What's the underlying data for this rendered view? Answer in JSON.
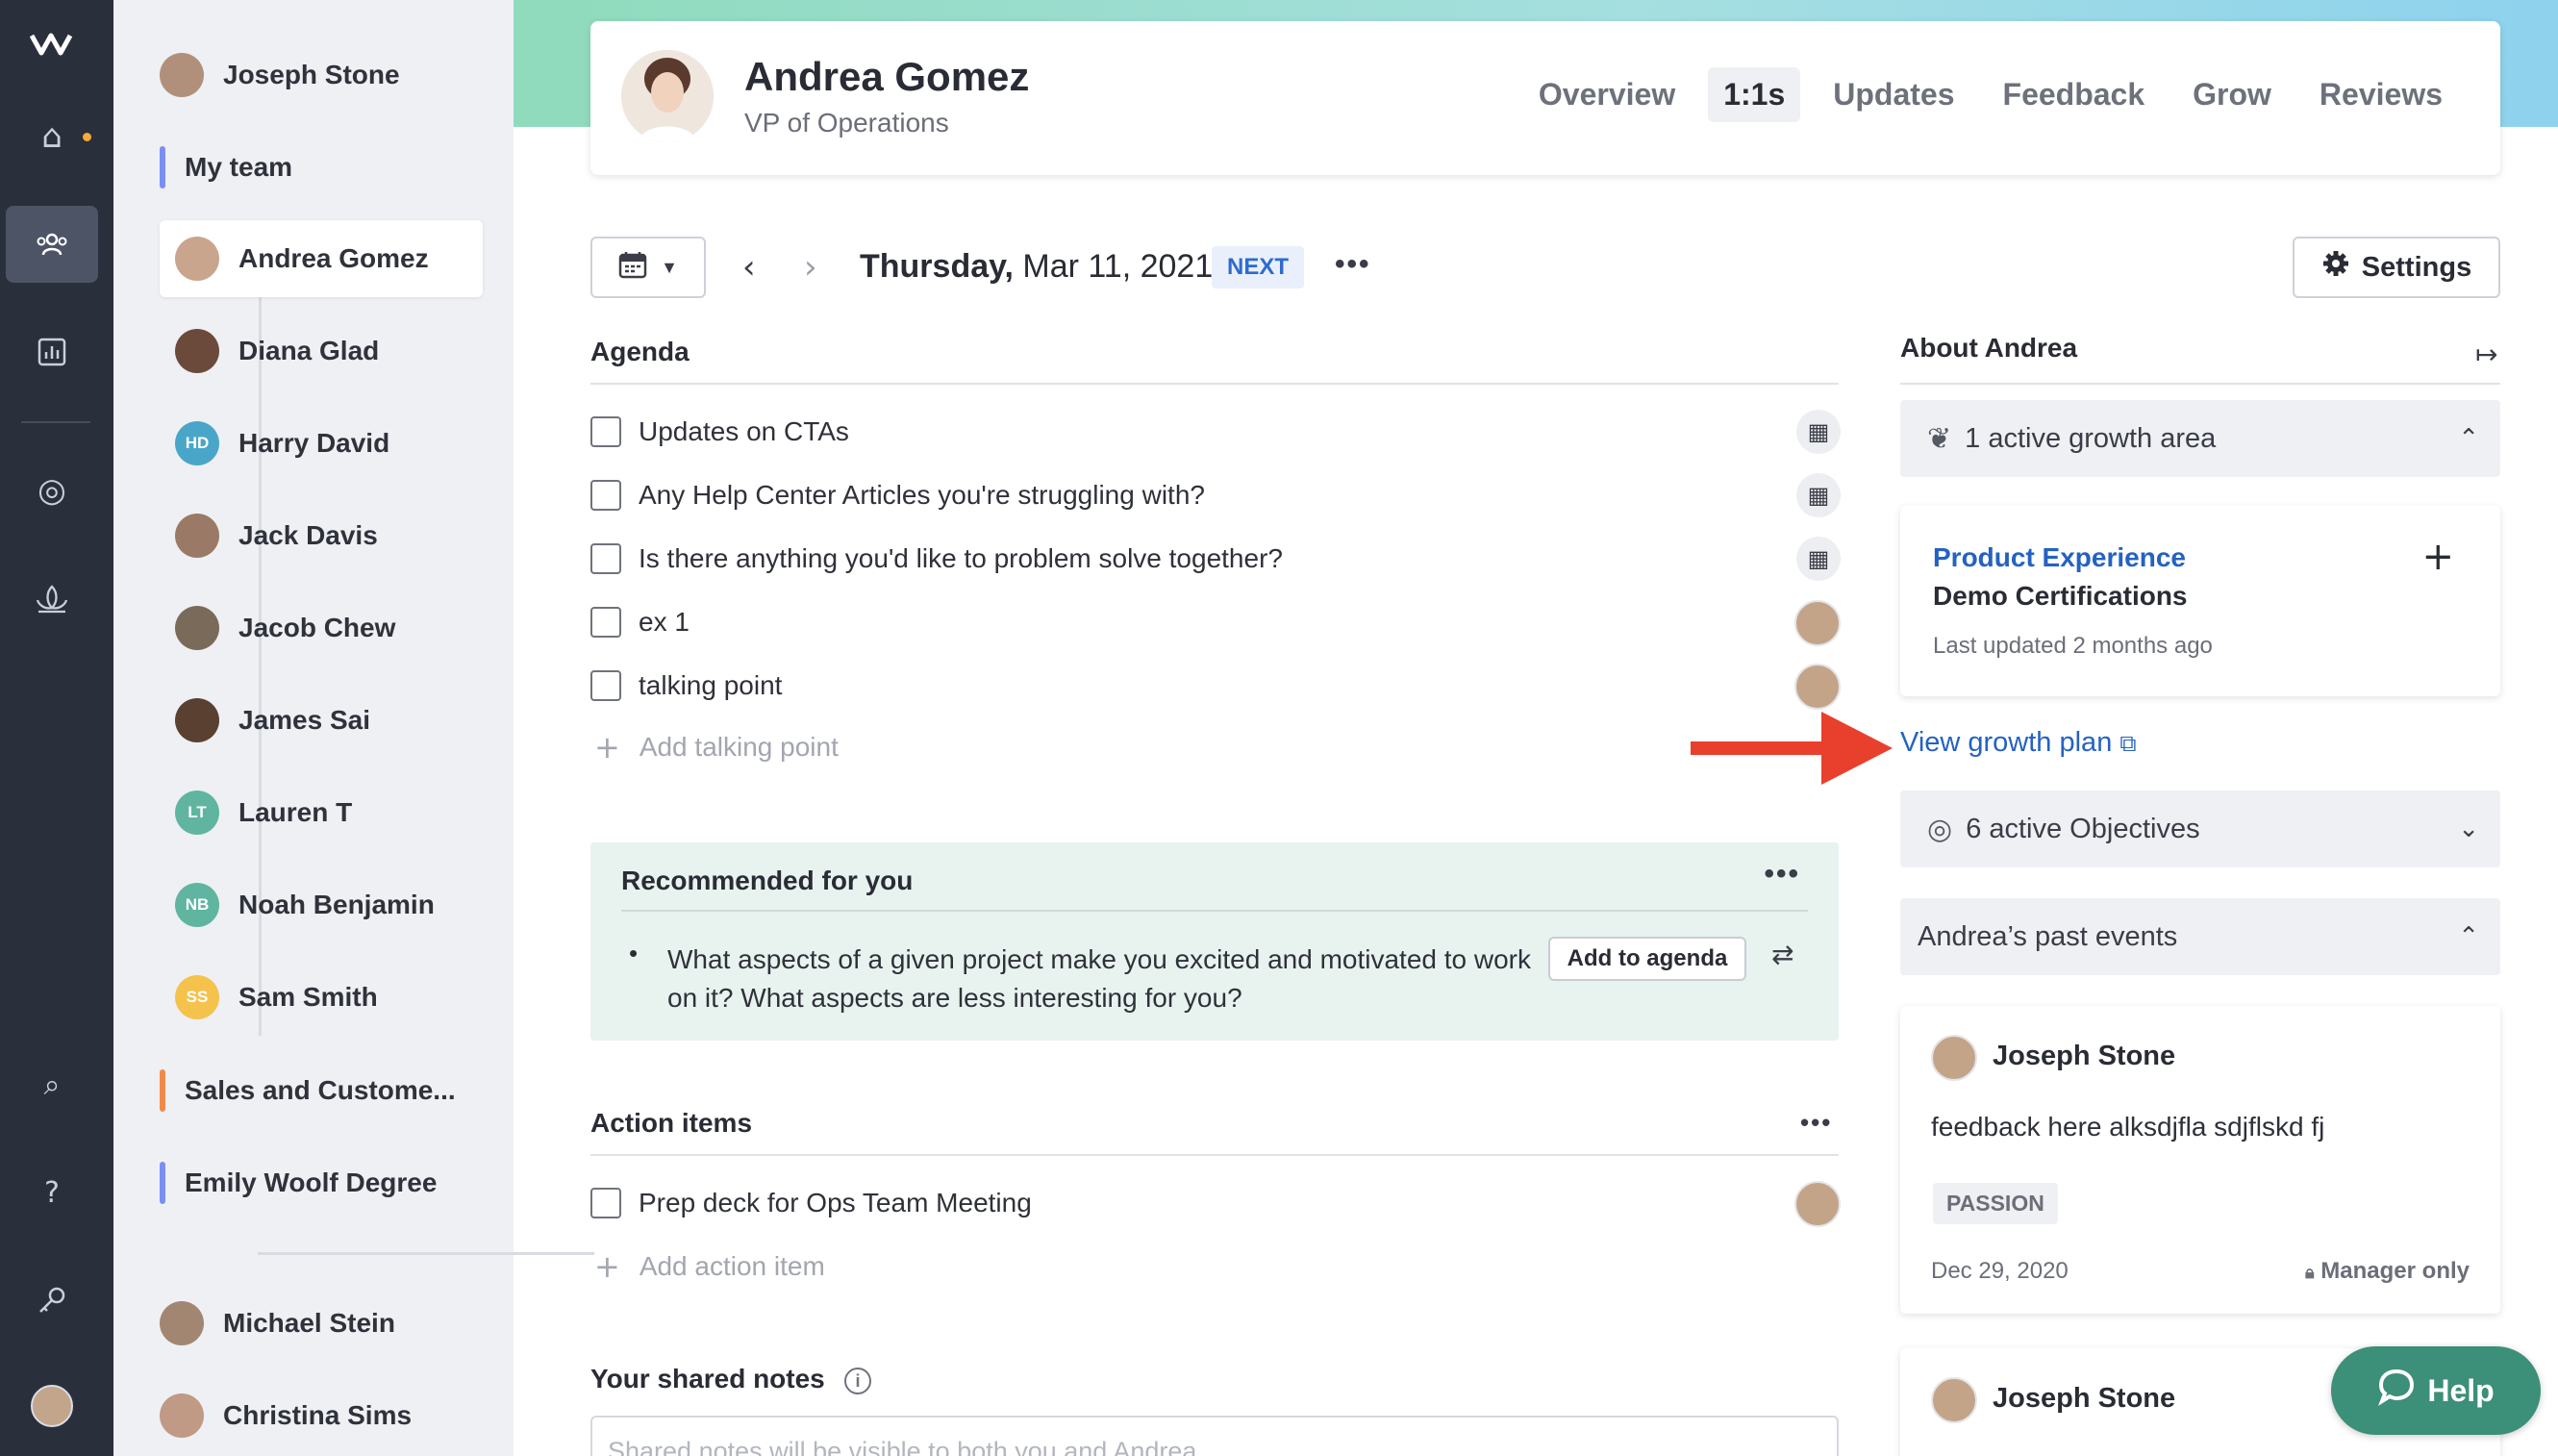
{
  "rail": {
    "icons": [
      "logo-icon",
      "home-icon",
      "team-icon",
      "analytics-icon",
      "objectives-icon",
      "growth-icon",
      "search-icon",
      "help-icon",
      "key-icon"
    ]
  },
  "sidebar": {
    "me": "Joseph Stone",
    "my_team": "My team",
    "team_members": [
      {
        "name": "Andrea Gomez",
        "initials": "",
        "color": "#c9a58e"
      },
      {
        "name": "Diana Glad",
        "initials": "",
        "color": "#6b4a3c"
      },
      {
        "name": "Harry David",
        "initials": "HD",
        "color": "#4aa6c9"
      },
      {
        "name": "Jack Davis",
        "initials": "",
        "color": "#9a7a66"
      },
      {
        "name": "Jacob Chew",
        "initials": "",
        "color": "#7a6a5a"
      },
      {
        "name": "James Sai",
        "initials": "",
        "color": "#5a4030"
      },
      {
        "name": "Lauren T",
        "initials": "LT",
        "color": "#5fb5a0"
      },
      {
        "name": "Noah Benjamin",
        "initials": "NB",
        "color": "#5fb5a0"
      },
      {
        "name": "Sam Smith",
        "initials": "SS",
        "color": "#f5c24c"
      }
    ],
    "groups": [
      {
        "label": "Sales and Custome...",
        "color": "#f08a4b"
      },
      {
        "label": "Emily Woolf Degree",
        "color": "#7b8ff0"
      }
    ],
    "others": [
      "Michael Stein",
      "Christina Sims"
    ]
  },
  "profile": {
    "name": "Andrea Gomez",
    "role": "VP of Operations",
    "tabs": [
      "Overview",
      "1:1s",
      "Updates",
      "Feedback",
      "Grow",
      "Reviews"
    ],
    "active_tab": "1:1s"
  },
  "meeting": {
    "weekday": "Thursday,",
    "date": "Mar 11, 2021",
    "badge": "NEXT",
    "settings_label": "Settings"
  },
  "agenda": {
    "title": "Agenda",
    "items": [
      {
        "text": "Updates on CTAs"
      },
      {
        "text": "Any Help Center Articles you're struggling with?"
      },
      {
        "text": "Is there anything you'd like to problem solve together?"
      },
      {
        "text": "ex 1"
      },
      {
        "text": "talking point"
      }
    ],
    "add_placeholder": "Add talking point"
  },
  "recommended": {
    "title": "Recommended for you",
    "question": "What aspects of a given project make you excited and motivated to work on it? What aspects are less interesting for you?",
    "add_label": "Add to agenda"
  },
  "actions": {
    "title": "Action items",
    "items": [
      {
        "text": "Prep deck for Ops Team Meeting"
      }
    ],
    "add_placeholder": "Add action item"
  },
  "notes": {
    "title": "Your shared notes",
    "placeholder": "Shared notes will be visible to both you and Andrea"
  },
  "about": {
    "title": "About Andrea",
    "growth_header": "1 active growth area",
    "growth_card": {
      "category": "Product Experience",
      "name": "Demo Certifications",
      "updated": "Last updated 2 months ago"
    },
    "view_link": "View growth plan",
    "objectives_header": "6 active Objectives",
    "past_events_header": "Andrea’s past events",
    "events": [
      {
        "author": "Joseph Stone",
        "text": "feedback here alksdjfla sdjflskd fj",
        "tag": "PASSION",
        "date": "Dec 29, 2020",
        "privacy": "Manager only"
      },
      {
        "author": "Joseph Stone"
      }
    ]
  },
  "help_label": "Help",
  "colors": {
    "accent_blue": "#2462c2",
    "arrow_red": "#e8402c",
    "help_green": "#3c8f78"
  }
}
